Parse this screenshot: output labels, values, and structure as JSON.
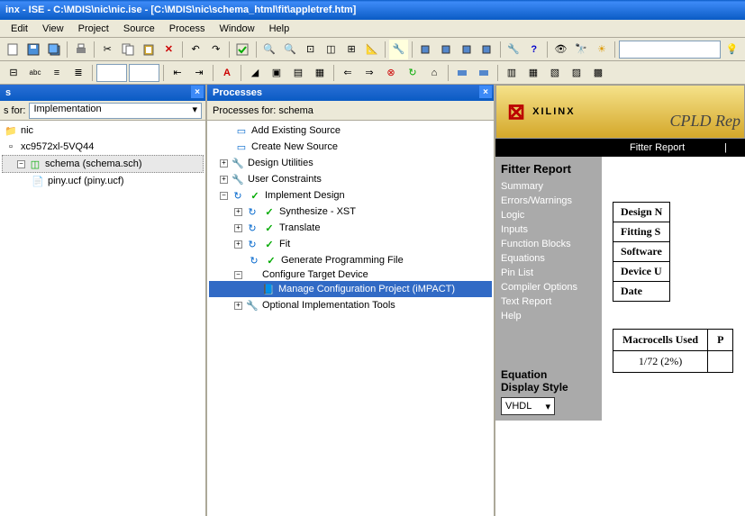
{
  "title": "inx - ISE - C:\\MDIS\\nic\\nic.ise - [C:\\MDIS\\nic\\schema_html\\fit\\appletref.htm]",
  "menu": [
    "Edit",
    "View",
    "Project",
    "Source",
    "Process",
    "Window",
    "Help"
  ],
  "sources": {
    "for_label": "s for:",
    "for_value": "Implementation",
    "items": {
      "device": "nic",
      "chip": "xc9572xl-5VQ44",
      "schema": "schema (schema.sch)",
      "piny": "piny.ucf (piny.ucf)"
    }
  },
  "processes": {
    "header": "Processes",
    "for_label": "Processes for: schema",
    "items": {
      "add_existing": "Add Existing Source",
      "create_new": "Create New Source",
      "design_util": "Design Utilities",
      "user_const": "User Constraints",
      "impl_design": "Implement Design",
      "synth": "Synthesize - XST",
      "translate": "Translate",
      "fit": "Fit",
      "gen_prog": "Generate Programming File",
      "config_target": "Configure Target Device",
      "manage_impact": "Manage Configuration Project (iMPACT)",
      "opt_impl": "Optional Implementation Tools"
    }
  },
  "report": {
    "brand": "XILINX",
    "subtitle": "CPLD Rep",
    "tab": "Fitter Report",
    "nav_title": "Fitter Report",
    "nav": [
      "Summary",
      "Errors/Warnings",
      "Logic",
      "Inputs",
      "Function Blocks",
      "Equations",
      "Pin List",
      "Compiler Options",
      "Text Report",
      "Help"
    ],
    "eq_label1": "Equation",
    "eq_label2": "Display Style",
    "eq_value": "VHDL",
    "info": [
      "Design N",
      "Fitting S",
      "Software",
      "Device U",
      "Date"
    ],
    "stats_hdr": [
      "Macrocells Used",
      "P"
    ],
    "stats_val": [
      "1/72  (2%)",
      ""
    ]
  }
}
